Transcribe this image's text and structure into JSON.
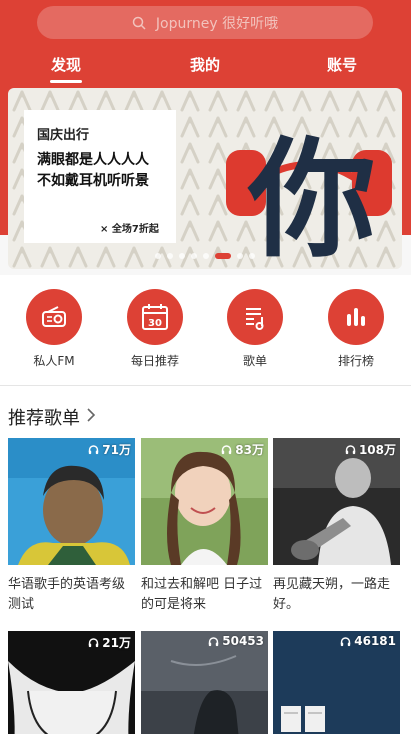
{
  "search": {
    "placeholder": "Jopurney 很好听哦"
  },
  "tabs": [
    "发现",
    "我的",
    "账号"
  ],
  "banner": {
    "card_title": "国庆出行",
    "card_text": "满眼都是人人人人\n不如戴耳机听听景",
    "card_promo": "全场7折起",
    "promo_mark": "×",
    "big_char": "你",
    "slide_count": 8,
    "active_slide": 5
  },
  "quick": [
    {
      "label": "私人FM",
      "icon": "radio-icon"
    },
    {
      "label": "每日推荐",
      "icon": "calendar-icon",
      "day": "30"
    },
    {
      "label": "歌单",
      "icon": "playlist-icon"
    },
    {
      "label": "排行榜",
      "icon": "ranking-icon"
    }
  ],
  "section": {
    "title": "推荐歌单"
  },
  "playlists": [
    {
      "count": "71万",
      "title": "华语歌手的英语考级测试"
    },
    {
      "count": "83万",
      "title": "和过去和解吧 日子过的可是将来"
    },
    {
      "count": "108万",
      "title": "再见藏天朔，一路走好。"
    },
    {
      "count": "21万",
      "title": ""
    },
    {
      "count": "50453",
      "title": ""
    },
    {
      "count": "46181",
      "title": ""
    }
  ],
  "colors": {
    "brand": "#dd4135"
  }
}
